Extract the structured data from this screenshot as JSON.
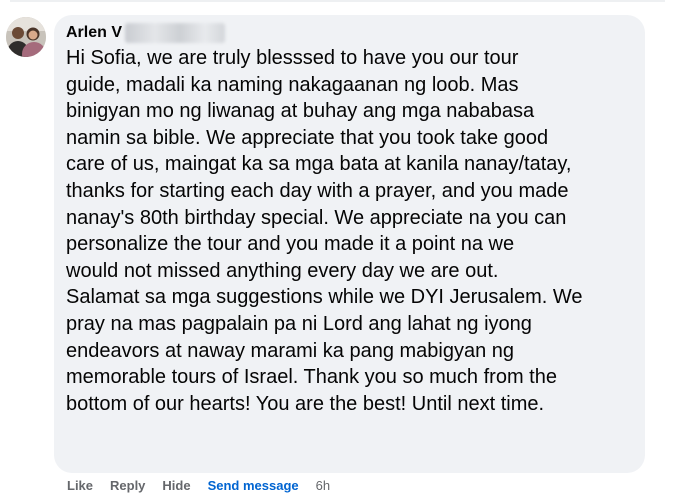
{
  "comment": {
    "author": "Arlen V",
    "author_blurred": true,
    "avatar_icon": "profile-photo",
    "text_lines": [
      "Hi Sofia, we are truly blesssed to have you our tour",
      "guide, madali ka naming nakagaanan ng loob. Mas",
      "binigyan mo ng liwanag at buhay ang mga nababasa",
      "namin sa bible. We appreciate that you took take good",
      "care of us, maingat ka sa mga bata at kanila nanay/tatay,",
      "thanks for starting each day with a prayer, and you made",
      "nanay's 80th birthday special. We appreciate na you can",
      "personalize the tour and you made it a point na we",
      "would not missed anything every day we are out.",
      "Salamat sa mga suggestions while we DYI Jerusalem. We",
      "pray na mas pagpalain pa ni Lord ang lahat ng iyong",
      "endeavors at naway marami ka pang mabigyan ng",
      "memorable tours of Israel. Thank you so much from the",
      "bottom of our hearts! You are the best! Until next time."
    ],
    "text": "Hi Sofia, we are truly blesssed to have you our tour\nguide, madali ka naming nakagaanan ng loob. Mas\nbinigyan mo ng liwanag at buhay ang mga nababasa\nnamin sa bible. We appreciate that you took take good\ncare of us, maingat ka sa mga bata at kanila nanay/tatay,\nthanks for starting each day with a prayer, and you made\nnanay's 80th birthday special. We appreciate na you can\npersonalize the tour and you made it a point na we\nwould not missed anything every day we are out.\nSalamat sa mga suggestions while we DYI Jerusalem. We\npray na mas pagpalain pa ni Lord ang lahat ng iyong\nendeavors at naway marami ka pang mabigyan ng\nmemorable tours of Israel. Thank you so much from the\nbottom of our hearts! You are the best! Until next time."
  },
  "actions": {
    "like": "Like",
    "reply": "Reply",
    "hide": "Hide",
    "send_message": "Send message",
    "timestamp": "6h"
  },
  "colors": {
    "bubble_bg": "#f0f2f5",
    "text": "#050505",
    "secondary_text": "#65676b",
    "link": "#0064d1"
  }
}
